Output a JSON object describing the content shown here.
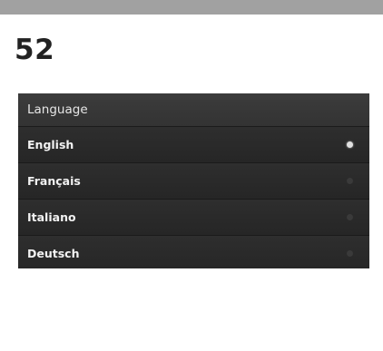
{
  "page": {
    "number": "52"
  },
  "language_panel": {
    "title": "Language",
    "options": [
      {
        "label": "English",
        "selected": true
      },
      {
        "label": "Français",
        "selected": false
      },
      {
        "label": "Italiano",
        "selected": false
      },
      {
        "label": "Deutsch",
        "selected": false
      }
    ]
  },
  "colors": {
    "top_bar": "#a1a1a1",
    "panel_background": "#2b2b2b",
    "selected_radio": "#e0e0e0",
    "unselected_radio": "#3a3a3a"
  }
}
